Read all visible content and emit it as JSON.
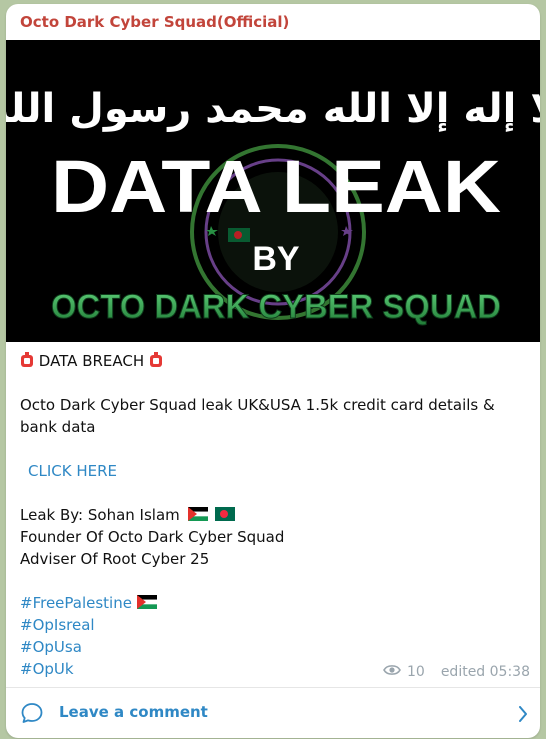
{
  "channel": {
    "name": "Octo Dark Cyber Squad(Official)"
  },
  "banner": {
    "arabic_text": "لا إله إلا الله محمد رسول الله",
    "headline": "DATA LEAK",
    "by": "BY",
    "group": "OCTO DARK CYBER SQUAD"
  },
  "message": {
    "alert": "DATA BREACH",
    "description": "Octo Dark Cyber Squad leak UK&USA 1.5k credit card details & bank data",
    "link_label": "CLICK HERE",
    "leak_by": "Leak By: Sohan Islam",
    "founder": "Founder Of Octo Dark Cyber Squad",
    "adviser": "Adviser Of Root Cyber 25",
    "hashtags": [
      "#FreePalestine",
      "#OpIsreal",
      "#OpUsa",
      "#OpUk"
    ]
  },
  "meta": {
    "views": "10",
    "edited": "edited 05:38",
    "eye_icon": "eye-icon"
  },
  "footer": {
    "comment_label": "Leave a comment",
    "comment_icon": "comment-icon",
    "arrow_icon": "chevron-right-icon"
  },
  "colors": {
    "channel_name": "#c2453b",
    "link": "#2f88c5",
    "banner_green": "#2fa84f"
  }
}
